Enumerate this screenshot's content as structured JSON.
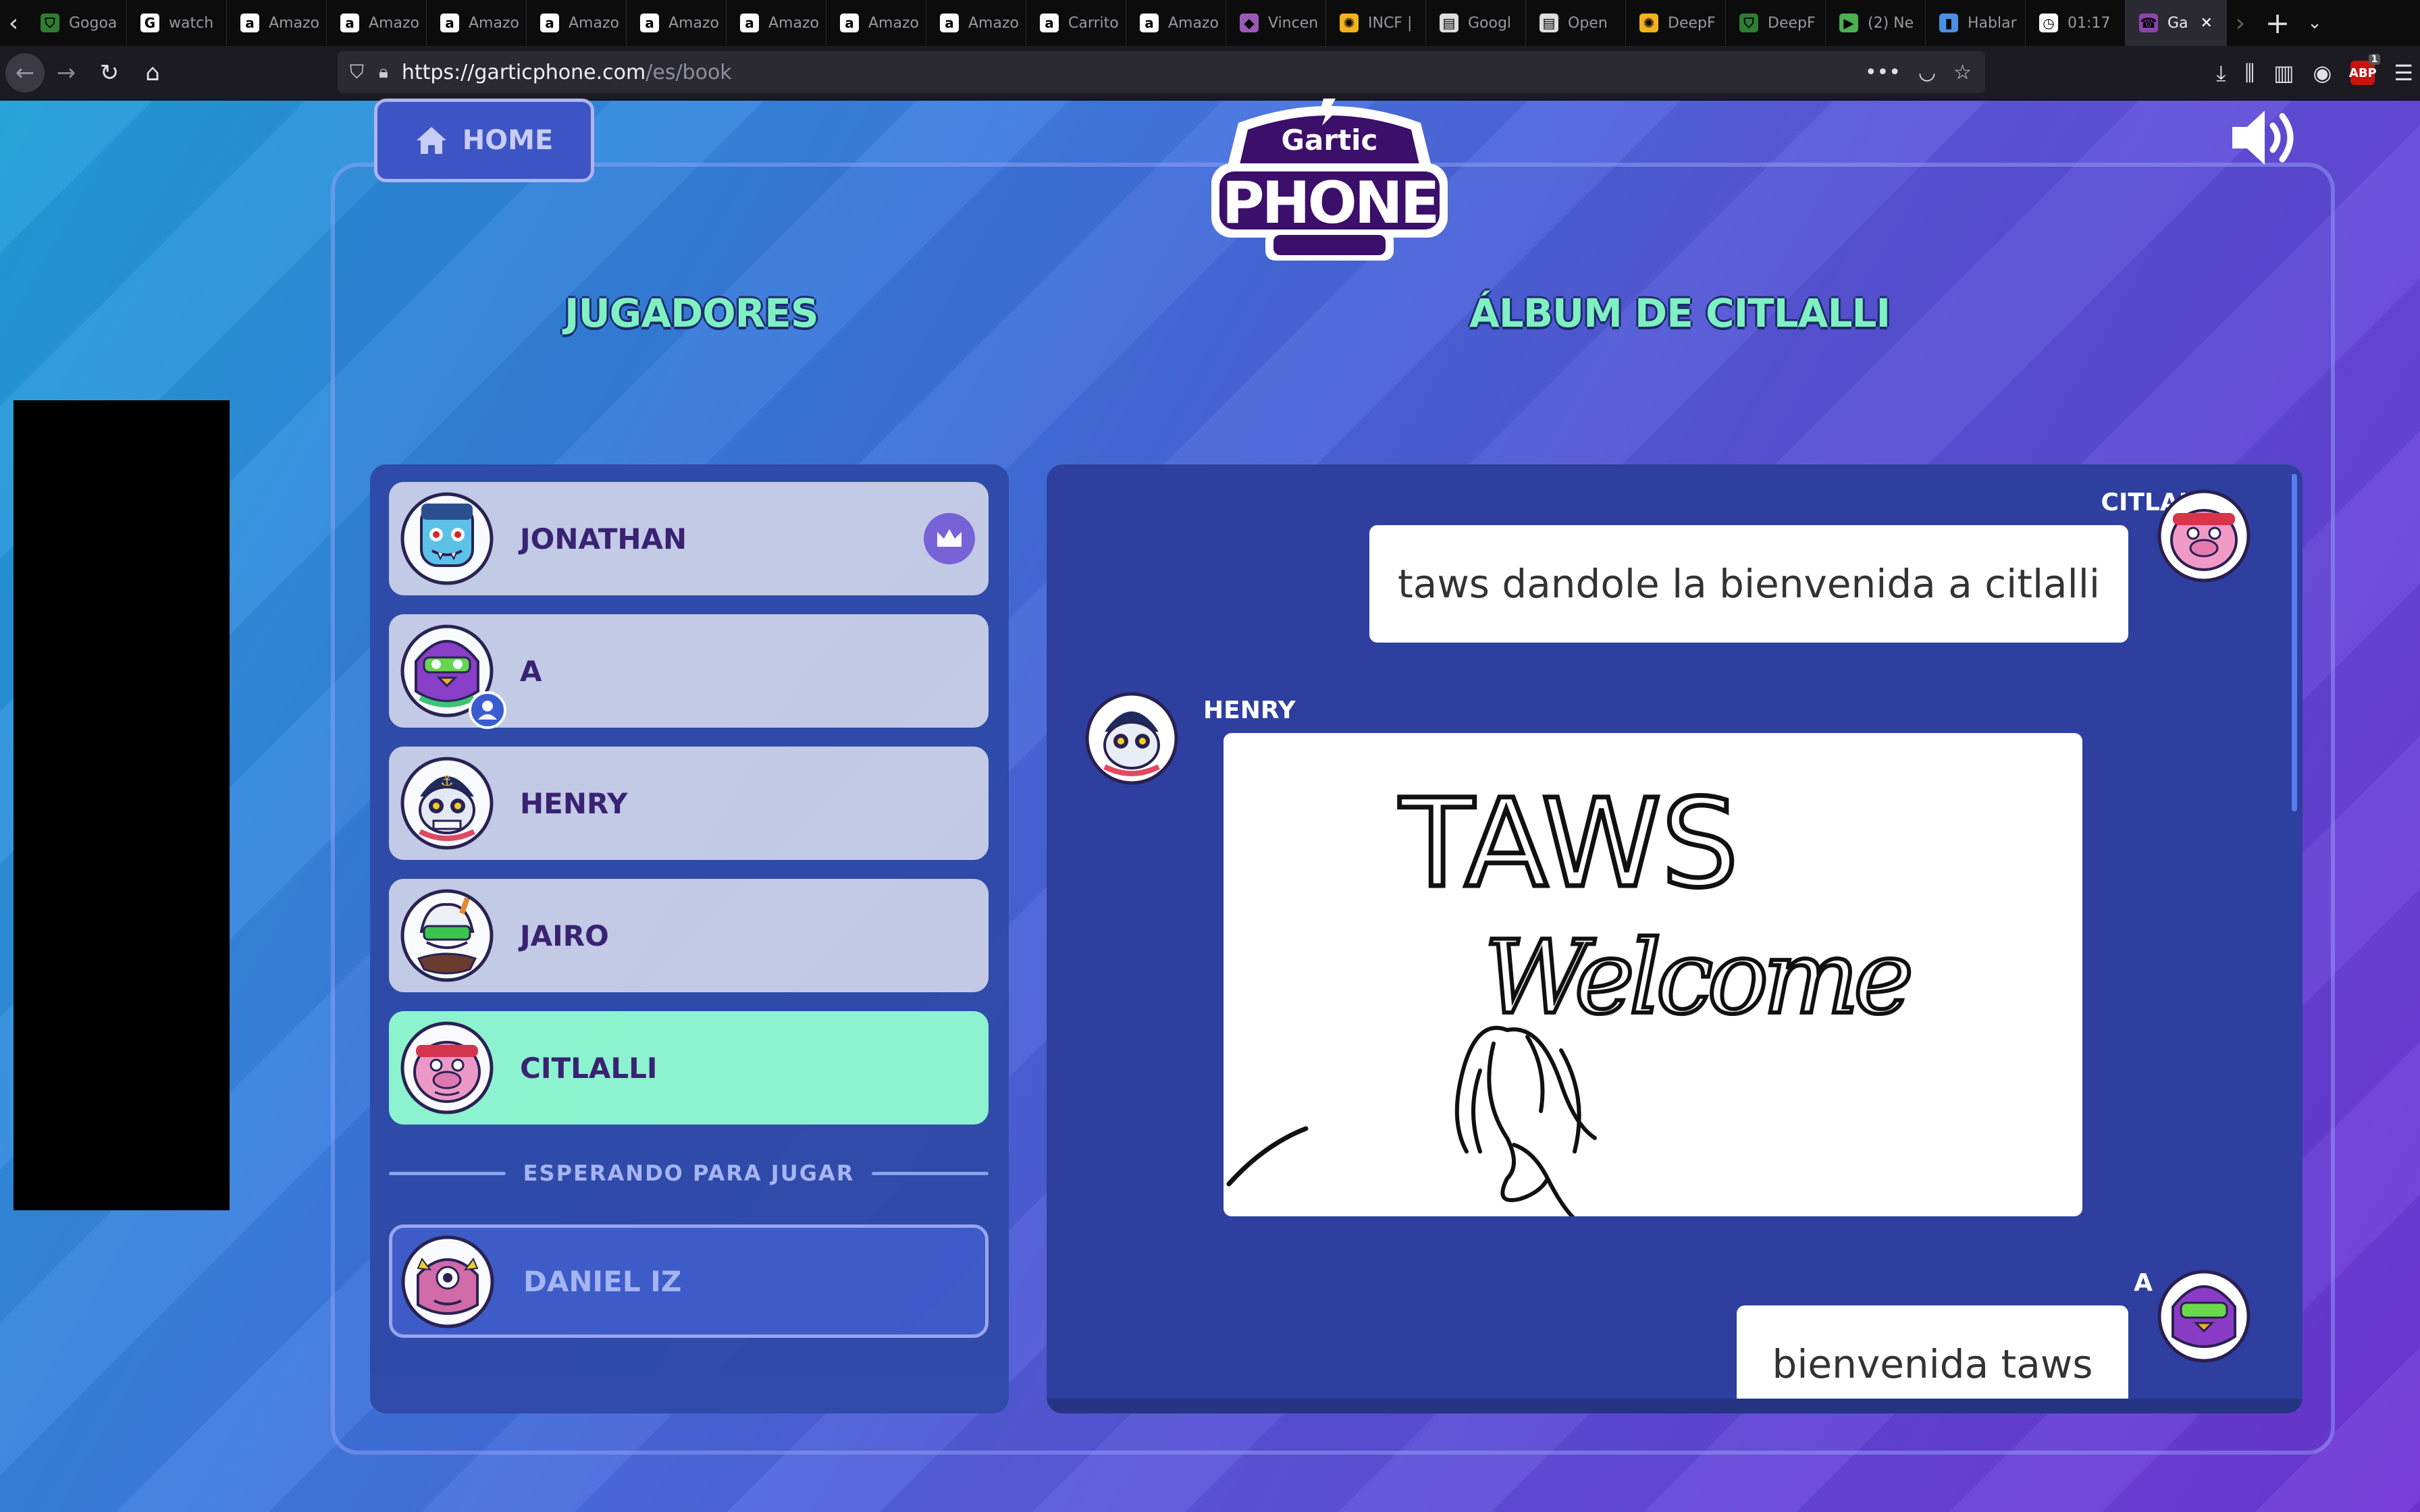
{
  "browser": {
    "tabs": [
      {
        "label": "Gogoa",
        "fav": "shield-icon"
      },
      {
        "label": "watch",
        "fav": "google-icon"
      },
      {
        "label": "Amazo",
        "fav": "amazon-icon"
      },
      {
        "label": "Amazo",
        "fav": "amazon-icon"
      },
      {
        "label": "Amazo",
        "fav": "amazon-icon"
      },
      {
        "label": "Amazo",
        "fav": "amazon-icon"
      },
      {
        "label": "Amazo",
        "fav": "amazon-icon"
      },
      {
        "label": "Amazo",
        "fav": "amazon-icon"
      },
      {
        "label": "Amazo",
        "fav": "amazon-icon"
      },
      {
        "label": "Amazo",
        "fav": "amazon-icon"
      },
      {
        "label": "Carrito",
        "fav": "amazon-icon"
      },
      {
        "label": "Amazo",
        "fav": "amazon-icon"
      },
      {
        "label": "Vincen",
        "fav": "shapes-icon"
      },
      {
        "label": "INCF |",
        "fav": "sun-icon"
      },
      {
        "label": "Googl",
        "fav": "docs-icon"
      },
      {
        "label": "Open",
        "fav": "docs-icon"
      },
      {
        "label": "DeepF",
        "fav": "sun-icon"
      },
      {
        "label": "DeepF",
        "fav": "shield-icon"
      },
      {
        "label": "(2) Ne",
        "fav": "play-icon"
      },
      {
        "label": "Hablar",
        "fav": "book-icon"
      },
      {
        "label": "01:17",
        "fav": "clock-icon"
      },
      {
        "label": "Ga",
        "fav": "phone-icon",
        "active": true
      }
    ],
    "url_host": "https://garticphone.com",
    "url_path": "/es/book",
    "abp_count": "1"
  },
  "header": {
    "home_label": "HOME",
    "logo_top": "Gartic",
    "logo_bottom": "PHONE"
  },
  "players": {
    "title": "JUGADORES",
    "list": [
      {
        "name": "JONATHAN",
        "avatar": "vampire-avatar",
        "host": true
      },
      {
        "name": "A",
        "avatar": "purple-bird-avatar"
      },
      {
        "name": "HENRY",
        "avatar": "sailor-skull-avatar"
      },
      {
        "name": "JAIRO",
        "avatar": "ice-cream-avatar"
      },
      {
        "name": "CITLALLI",
        "avatar": "pig-avatar",
        "current": true
      }
    ],
    "waiting_label": "ESPERANDO PARA JUGAR",
    "waiting": [
      {
        "name": "DANIEL IZ",
        "avatar": "pink-cyclops-avatar"
      }
    ]
  },
  "album": {
    "title": "ÁLBUM DE CITLALLI",
    "entries": [
      {
        "author": "CITLALLI",
        "type": "text",
        "text": "taws dandole la bienvenida a citlalli"
      },
      {
        "author": "HENRY",
        "type": "drawing",
        "drawing_text": [
          "TAWS",
          "Welcome"
        ]
      },
      {
        "author": "A",
        "type": "text",
        "text": "bienvenida taws"
      }
    ]
  },
  "colors": {
    "accent_green": "#7ff0c2",
    "current_player": "#8ff7cf",
    "player_card": "#c7cde6",
    "name_purple": "#3a2070"
  }
}
